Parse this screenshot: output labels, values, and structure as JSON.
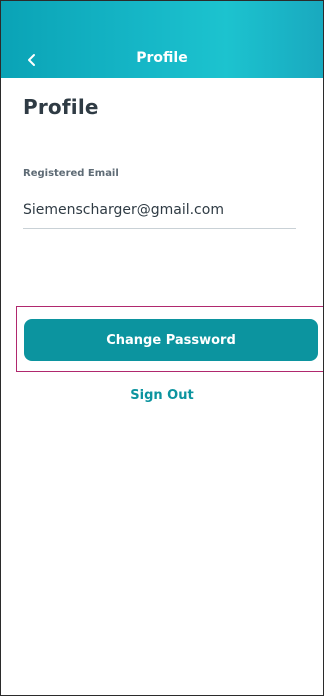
{
  "header": {
    "title": "Profile"
  },
  "page": {
    "title": "Profile"
  },
  "profile": {
    "email_label": "Registered Email",
    "email_value": "Siemenscharger@gmail.com"
  },
  "actions": {
    "change_password_label": "Change Password",
    "sign_out_label": "Sign Out"
  },
  "colors": {
    "accent": "#0c949f",
    "header_gradient_start": "#0aa3b6",
    "header_gradient_end": "#1cc3cf",
    "highlight_border": "#b0286e"
  },
  "icons": {
    "back": "chevron-left-icon"
  }
}
